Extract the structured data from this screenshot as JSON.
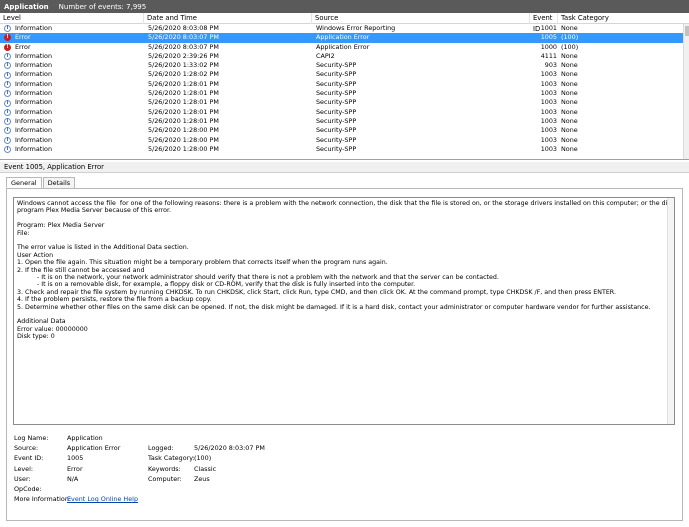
{
  "header": {
    "title": "Application",
    "count_text": "Number of events: 7,995"
  },
  "list": {
    "columns": [
      "Level",
      "Date and Time",
      "Source",
      "Event ID",
      "Task Category"
    ],
    "rows": [
      {
        "level": "Information",
        "icon": "info-icon",
        "date": "5/26/2020 8:03:08 PM",
        "source": "Windows Error Reporting",
        "id": "1001",
        "task": "None"
      },
      {
        "level": "Error",
        "icon": "error-icon",
        "date": "5/26/2020 8:03:07 PM",
        "source": "Application Error",
        "id": "1005",
        "task": "(100)"
      },
      {
        "level": "Error",
        "icon": "error-icon",
        "date": "5/26/2020 8:03:07 PM",
        "source": "Application Error",
        "id": "1000",
        "task": "(100)"
      },
      {
        "level": "Information",
        "icon": "info-icon",
        "date": "5/26/2020 2:39:26 PM",
        "source": "CAPI2",
        "id": "4111",
        "task": "None"
      },
      {
        "level": "Information",
        "icon": "info-icon",
        "date": "5/26/2020 1:33:02 PM",
        "source": "Security-SPP",
        "id": "903",
        "task": "None"
      },
      {
        "level": "Information",
        "icon": "info-icon",
        "date": "5/26/2020 1:28:02 PM",
        "source": "Security-SPP",
        "id": "1003",
        "task": "None"
      },
      {
        "level": "Information",
        "icon": "info-icon",
        "date": "5/26/2020 1:28:01 PM",
        "source": "Security-SPP",
        "id": "1003",
        "task": "None"
      },
      {
        "level": "Information",
        "icon": "info-icon",
        "date": "5/26/2020 1:28:01 PM",
        "source": "Security-SPP",
        "id": "1003",
        "task": "None"
      },
      {
        "level": "Information",
        "icon": "info-icon",
        "date": "5/26/2020 1:28:01 PM",
        "source": "Security-SPP",
        "id": "1003",
        "task": "None"
      },
      {
        "level": "Information",
        "icon": "info-icon",
        "date": "5/26/2020 1:28:01 PM",
        "source": "Security-SPP",
        "id": "1003",
        "task": "None"
      },
      {
        "level": "Information",
        "icon": "info-icon",
        "date": "5/26/2020 1:28:01 PM",
        "source": "Security-SPP",
        "id": "1003",
        "task": "None"
      },
      {
        "level": "Information",
        "icon": "info-icon",
        "date": "5/26/2020 1:28:00 PM",
        "source": "Security-SPP",
        "id": "1003",
        "task": "None"
      },
      {
        "level": "Information",
        "icon": "info-icon",
        "date": "5/26/2020 1:28:00 PM",
        "source": "Security-SPP",
        "id": "1003",
        "task": "None"
      },
      {
        "level": "Information",
        "icon": "info-icon",
        "date": "5/26/2020 1:28:00 PM",
        "source": "Security-SPP",
        "id": "1003",
        "task": "None"
      }
    ],
    "selected_row": "1",
    "selected_color": "#3399ff"
  },
  "detail": {
    "title": "Event 1005, Application Error",
    "tabs": [
      "General",
      "Details"
    ],
    "description_lines": [
      "Windows cannot access the file  for one of the following reasons: there is a problem with the network connection, the disk that the file is stored on, or the storage drivers installed on this computer; or the disk is missing. Windows closed the",
      "program Plex Media Server because of this error.",
      "",
      "Program: Plex Media Server",
      "File:",
      "",
      "The error value is listed in the Additional Data section.",
      "User Action",
      "1. Open the file again. This situation might be a temporary problem that corrects itself when the program runs again.",
      "2. If the file still cannot be accessed and",
      "          - It is on the network, your network administrator should verify that there is not a problem with the network and that the server can be contacted.",
      "          - It is on a removable disk, for example, a floppy disk or CD-ROM, verify that the disk is fully inserted into the computer.",
      "3. Check and repair the file system by running CHKDSK. To run CHKDSK, click Start, click Run, type CMD, and then click OK. At the command prompt, type CHKDSK /F, and then press ENTER.",
      "4. If the problem persists, restore the file from a backup copy.",
      "5. Determine whether other files on the same disk can be opened. If not, the disk might be damaged. If it is a hard disk, contact your administrator or computer hardware vendor for further assistance.",
      "",
      "Additional Data",
      "Error value: 00000000",
      "Disk type: 0"
    ],
    "props": {
      "log_name_label": "Log Name:",
      "log_name": "Application",
      "source_label": "Source:",
      "source": "Application Error",
      "logged_label": "Logged:",
      "logged": "5/26/2020 8:03:07 PM",
      "event_id_label": "Event ID:",
      "event_id": "1005",
      "task_label": "Task Category:",
      "task": "(100)",
      "level_label": "Level:",
      "level": "Error",
      "keywords_label": "Keywords:",
      "keywords": "Classic",
      "user_label": "User:",
      "user": "N/A",
      "computer_label": "Computer:",
      "computer": "Zeus",
      "opcode_label": "OpCode:",
      "opcode": "",
      "more_info_label": "More Information:",
      "more_info_link": "Event Log Online Help"
    }
  }
}
